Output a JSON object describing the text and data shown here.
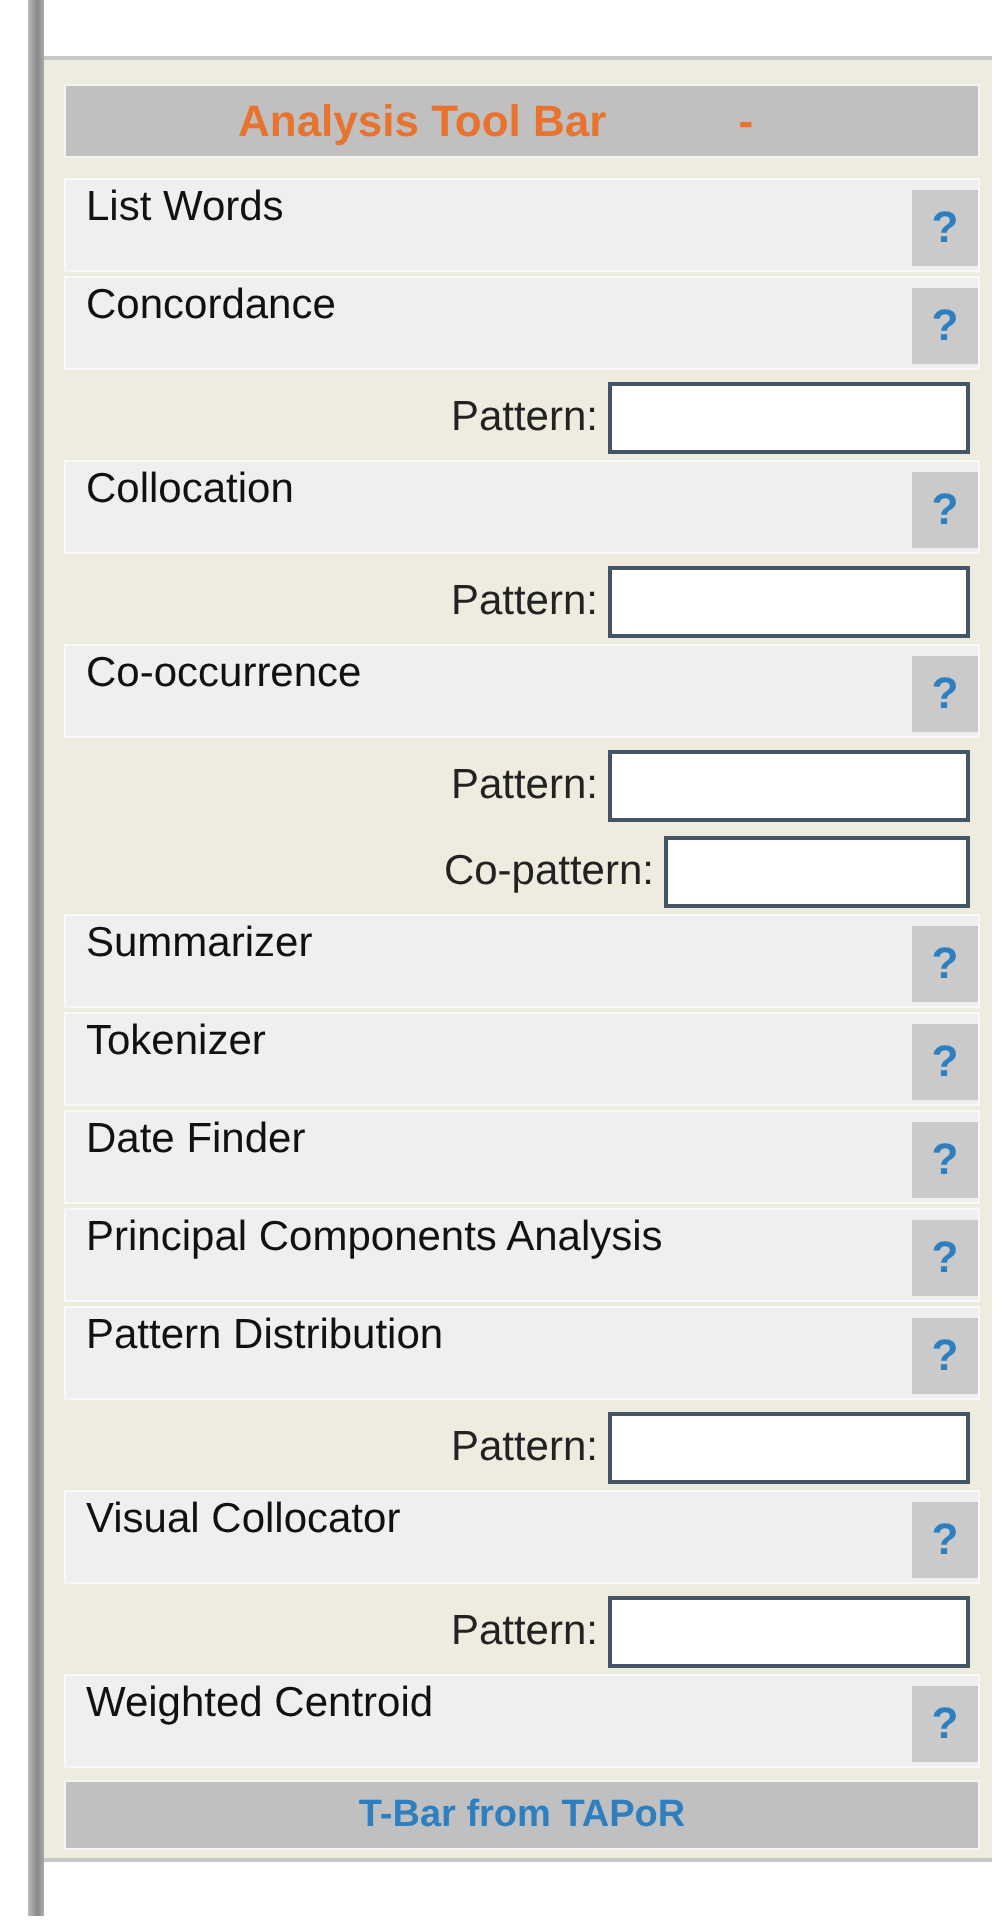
{
  "toolbar": {
    "title": "Analysis Tool Bar",
    "collapse": "-"
  },
  "tools": [
    {
      "name": "List Words",
      "help": "?"
    },
    {
      "name": "Concordance",
      "help": "?",
      "fields": [
        {
          "label": "Pattern:"
        }
      ]
    },
    {
      "name": "Collocation",
      "help": "?",
      "fields": [
        {
          "label": "Pattern:"
        }
      ]
    },
    {
      "name": "Co-occurrence",
      "help": "?",
      "fields": [
        {
          "label": "Pattern:"
        },
        {
          "label": "Co-pattern:"
        }
      ]
    },
    {
      "name": "Summarizer",
      "help": "?"
    },
    {
      "name": "Tokenizer",
      "help": "?"
    },
    {
      "name": "Date Finder",
      "help": "?"
    },
    {
      "name": "Principal Components Analysis",
      "help": "?"
    },
    {
      "name": "Pattern Distribution",
      "help": "?",
      "fields": [
        {
          "label": "Pattern:"
        }
      ]
    },
    {
      "name": "Visual Collocator",
      "help": "?",
      "fields": [
        {
          "label": "Pattern:"
        }
      ]
    },
    {
      "name": "Weighted Centroid",
      "help": "?"
    }
  ],
  "footer": "T-Bar from TAPoR"
}
